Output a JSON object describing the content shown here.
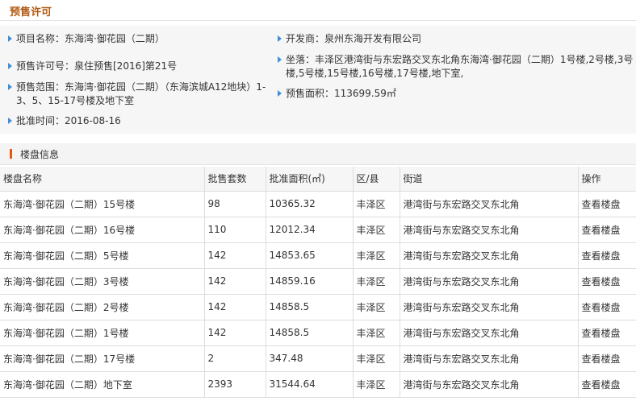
{
  "permit": {
    "title": "预售许可",
    "project_name": "项目名称：东海湾·御花园（二期）",
    "developer": "开发商：泉州东海开发有限公司",
    "permit_no": "预售许可号：泉住预售[2016]第21号",
    "location": "坐落：丰泽区港湾街与东宏路交叉东北角东海湾·御花园（二期）1号楼,2号楼,3号楼,5号楼,15号楼,16号楼,17号楼,地下室,",
    "scope": "预售范围：东海湾·御花园（二期）（东海滨城A12地块）1-3、5、15-17号楼及地下室",
    "area": "预售面积：113699.59㎡",
    "approval_date": "批准时间：2016-08-16"
  },
  "buildings": {
    "section_title": "楼盘信息",
    "columns": [
      "楼盘名称",
      "批售套数",
      "批准面积(㎡)",
      "区/县",
      "街道",
      "操作"
    ],
    "rows": [
      [
        "东海湾·御花园（二期）15号楼",
        "98",
        "10365.32",
        "丰泽区",
        "港湾街与东宏路交叉东北角",
        "查看楼盘"
      ],
      [
        "东海湾·御花园（二期）16号楼",
        "110",
        "12012.34",
        "丰泽区",
        "港湾街与东宏路交叉东北角",
        "查看楼盘"
      ],
      [
        "东海湾·御花园（二期）5号楼",
        "142",
        "14853.65",
        "丰泽区",
        "港湾街与东宏路交叉东北角",
        "查看楼盘"
      ],
      [
        "东海湾·御花园（二期）3号楼",
        "142",
        "14859.16",
        "丰泽区",
        "港湾街与东宏路交叉东北角",
        "查看楼盘"
      ],
      [
        "东海湾·御花园（二期）2号楼",
        "142",
        "14858.5",
        "丰泽区",
        "港湾街与东宏路交叉东北角",
        "查看楼盘"
      ],
      [
        "东海湾·御花园（二期）1号楼",
        "142",
        "14858.5",
        "丰泽区",
        "港湾街与东宏路交叉东北角",
        "查看楼盘"
      ],
      [
        "东海湾·御花园（二期）17号楼",
        "2",
        "347.48",
        "丰泽区",
        "港湾街与东宏路交叉东北角",
        "查看楼盘"
      ],
      [
        "东海湾·御花园（二期）地下室",
        "2393",
        "31544.64",
        "丰泽区",
        "港湾街与东宏路交叉东北角",
        "查看楼盘"
      ]
    ]
  },
  "colors": {
    "title": "#b25a12",
    "arrow": "#3f8fd8",
    "section_bar": "#e25a10"
  },
  "icons": {
    "bullet": "triangle-right-icon"
  }
}
